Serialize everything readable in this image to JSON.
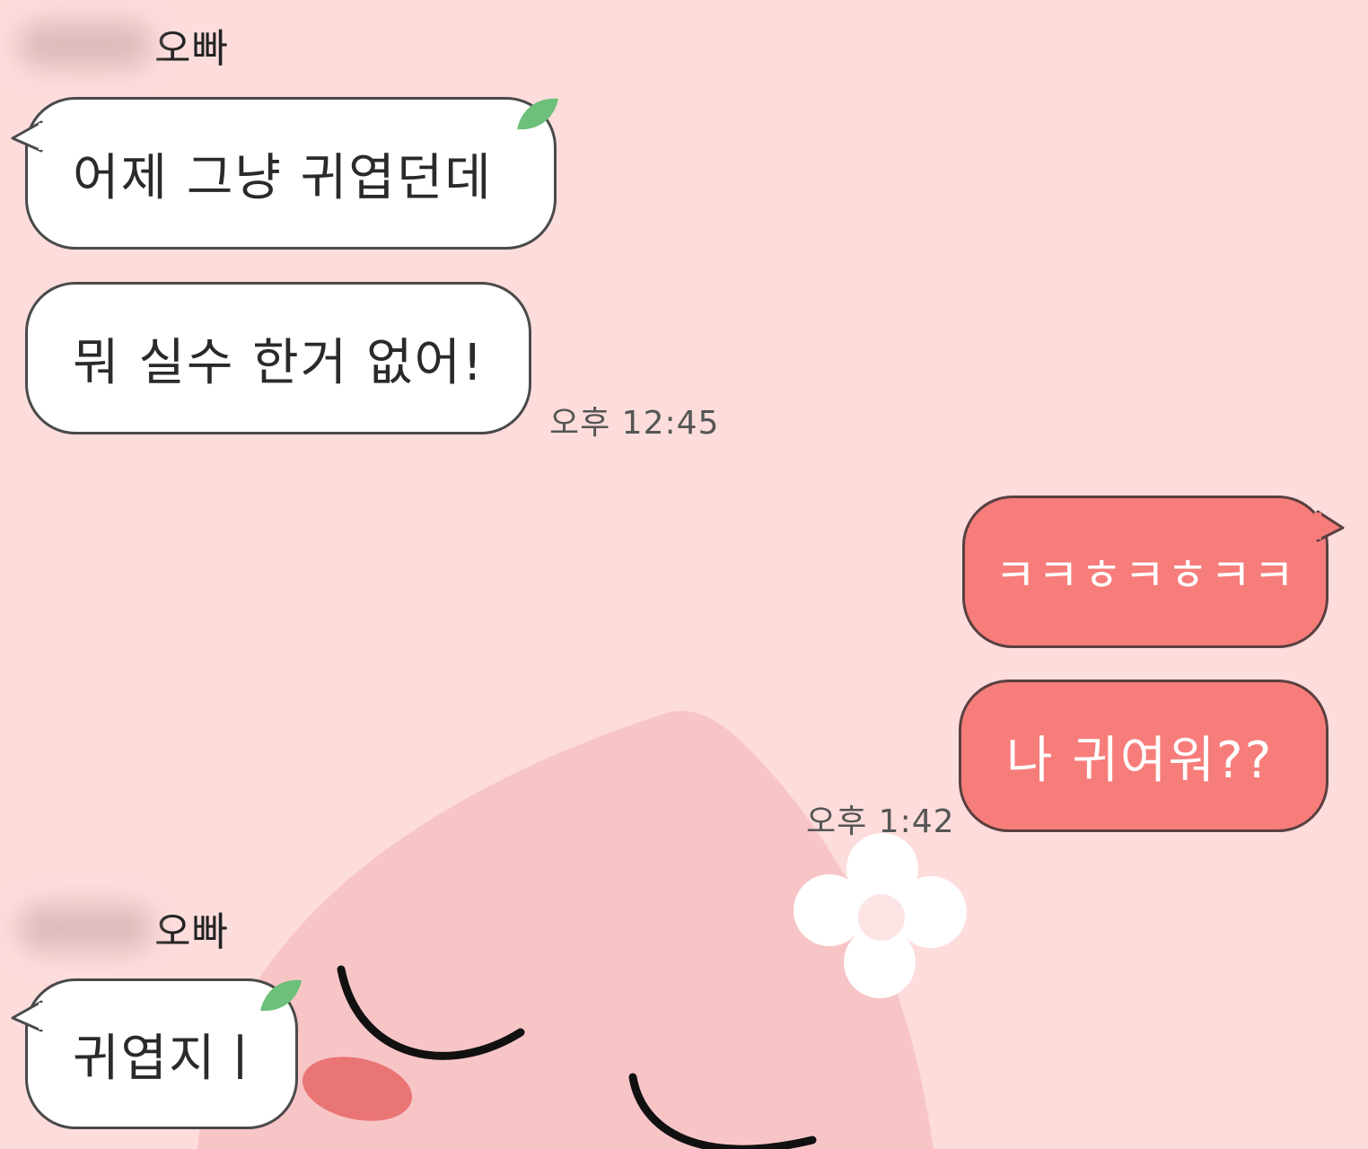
{
  "colors": {
    "background": "#fddcdc",
    "received_bubble": "#ffffff",
    "sent_bubble": "#f77d7b",
    "leaf": "#6cc07a"
  },
  "messages": {
    "group1": {
      "sender_suffix": "오빠",
      "bubble1_text": "어제 그냥 귀엽던데",
      "bubble2_text": "뭐 실수 한거 없어!",
      "time": "오후 12:45"
    },
    "group2": {
      "bubble1_text": "ㅋㅋㅎㅋㅎㅋㅋ",
      "bubble2_text": "나 귀여워??",
      "time": "오후 1:42"
    },
    "group3": {
      "sender_suffix": "오빠",
      "bubble1_text": "귀엽지ㅣ"
    }
  },
  "icons": {
    "leaf": "leaf-icon",
    "flower": "flower-icon",
    "peach": "peach-character"
  }
}
